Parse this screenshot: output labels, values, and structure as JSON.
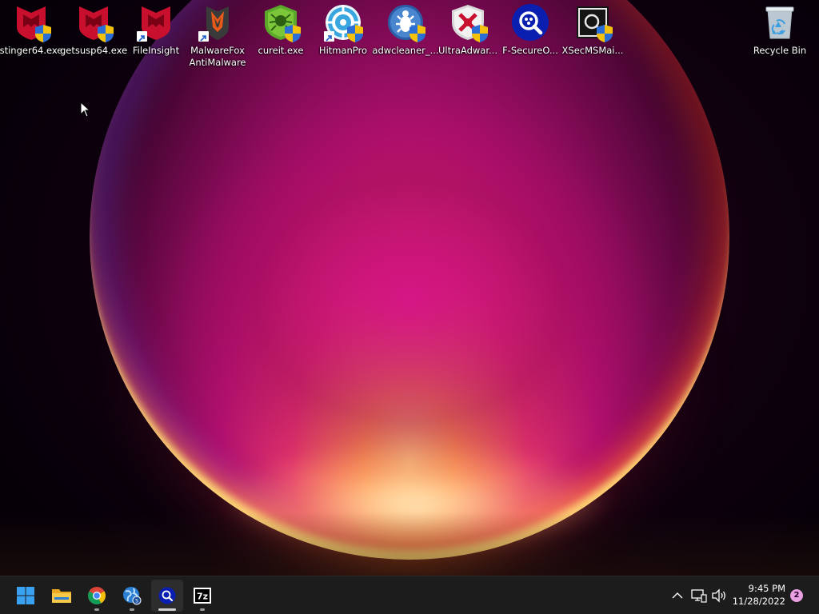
{
  "desktop": {
    "icons": [
      {
        "label": "stinger64.exe",
        "icon": "mcafee-shield-icon"
      },
      {
        "label": "getsusp64.exe",
        "icon": "mcafee-shield-icon"
      },
      {
        "label": "FileInsight",
        "icon": "mcafee-shield-icon"
      },
      {
        "label": "MalwareFox\nAntiMalware",
        "icon": "malwarefox-icon"
      },
      {
        "label": "cureit.exe",
        "icon": "drweb-spider-icon"
      },
      {
        "label": "HitmanPro",
        "icon": "hitmanpro-icon"
      },
      {
        "label": "adwcleaner_...",
        "icon": "adwcleaner-icon"
      },
      {
        "label": "UltraAdwar...",
        "icon": "ultraadware-icon"
      },
      {
        "label": "F-SecureO...",
        "icon": "fsecure-icon"
      },
      {
        "label": "XSecMSMai...",
        "icon": "xsec-icon"
      },
      {
        "label": "Recycle Bin",
        "icon": "recycle-bin-icon"
      }
    ]
  },
  "taskbar": {
    "apps": [
      {
        "name": "Start",
        "icon": "windows-start-icon"
      },
      {
        "name": "File Explorer",
        "icon": "folder-icon"
      },
      {
        "name": "Google Chrome",
        "icon": "chrome-icon"
      },
      {
        "name": "Globe app",
        "icon": "globe-icon"
      },
      {
        "name": "Search tool",
        "icon": "magnifier-icon"
      },
      {
        "name": "7-Zip",
        "icon": "sevenzip-icon"
      }
    ],
    "tray": {
      "time": "9:45 PM",
      "date": "11/28/2022",
      "notification_count": "2"
    }
  },
  "colors": {
    "taskbar_bg": "#1c1c1c",
    "mcafee_red": "#c8102e",
    "start_blue": "#3aa0f0",
    "notification_badge": "#e8a0e0"
  }
}
